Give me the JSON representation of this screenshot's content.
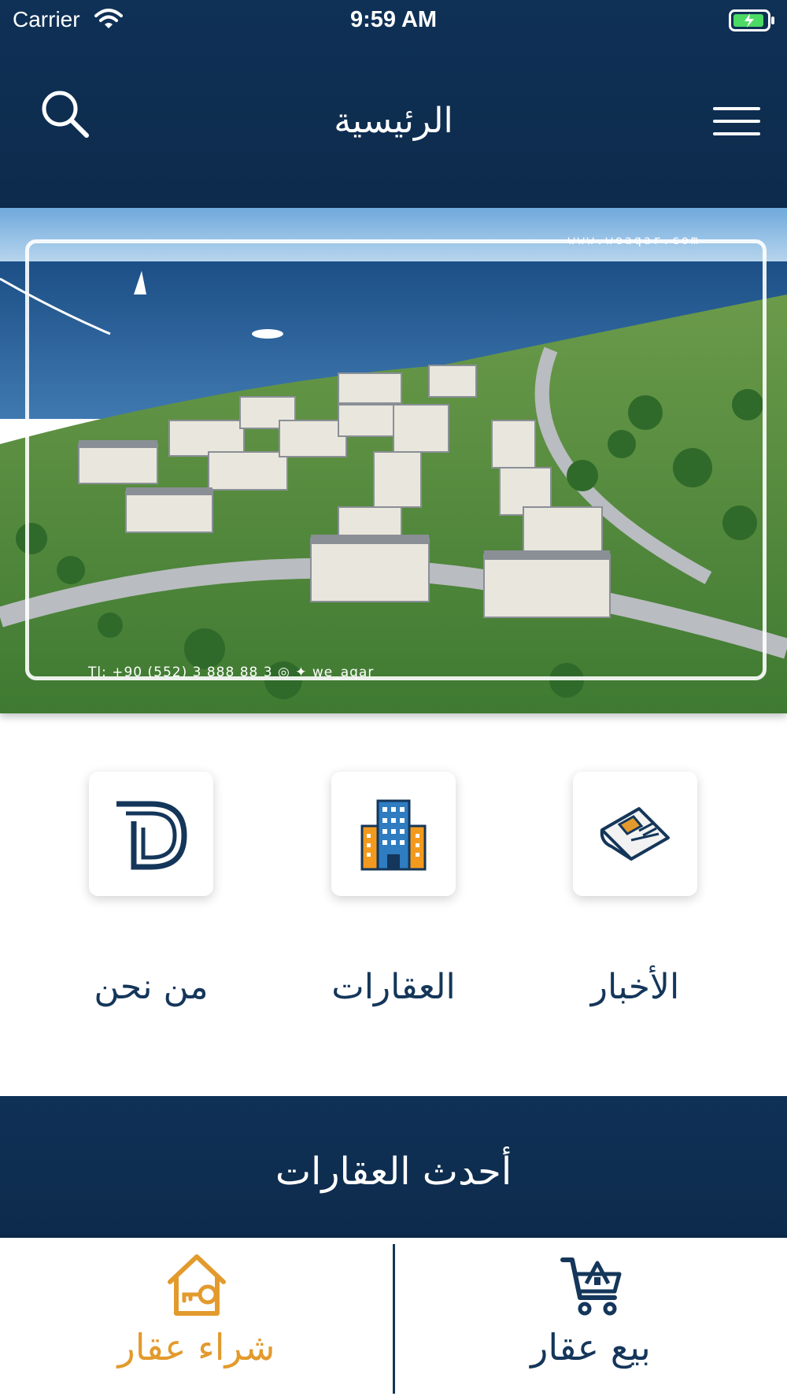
{
  "status_bar": {
    "carrier": "Carrier",
    "time": "9:59 AM"
  },
  "header": {
    "title": "الرئيسية",
    "search_icon": "search-icon",
    "menu_icon": "hamburger-menu-icon"
  },
  "banner": {
    "url_text": "www.weaqar.com",
    "contact_text": "Tl: +90 (552) 3 888 88 3  ◎ ✦ we_aqar"
  },
  "categories": [
    {
      "label": "الأخبار",
      "icon": "newspaper-icon"
    },
    {
      "label": "العقارات",
      "icon": "building-icon"
    },
    {
      "label": "من نحن",
      "icon": "company-logo-icon"
    }
  ],
  "latest": {
    "title": "أحدث العقارات"
  },
  "tabbar": {
    "buy": {
      "label": "شراء عقار",
      "icon": "house-key-icon",
      "color": "#e39a2d"
    },
    "sell": {
      "label": "بيع عقار",
      "icon": "cart-icon",
      "color": "#14365a"
    }
  },
  "colors": {
    "primary": "#0f3156",
    "accent": "#e39a2d",
    "text": "#14365a"
  }
}
